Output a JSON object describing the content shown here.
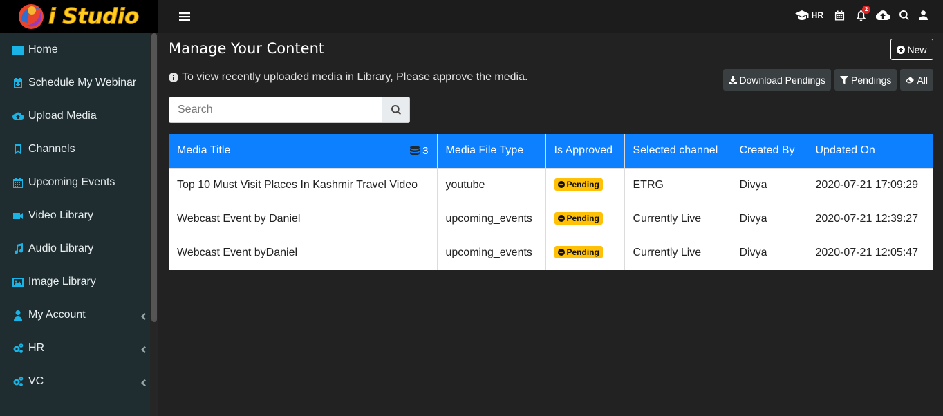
{
  "app": {
    "name": "i Studio"
  },
  "sidebar": {
    "items": [
      {
        "label": "Home",
        "icon": "home-icon",
        "has_chevron": false
      },
      {
        "label": "Schedule My Webinar",
        "icon": "calendar-plus-icon",
        "has_chevron": false
      },
      {
        "label": "Upload Media",
        "icon": "cloud-upload-icon",
        "has_chevron": false
      },
      {
        "label": "Channels",
        "icon": "bookmark-icon",
        "has_chevron": false
      },
      {
        "label": "Upcoming Events",
        "icon": "calendar-icon",
        "has_chevron": false
      },
      {
        "label": "Video Library",
        "icon": "video-icon",
        "has_chevron": false
      },
      {
        "label": "Audio Library",
        "icon": "music-icon",
        "has_chevron": false
      },
      {
        "label": "Image Library",
        "icon": "image-icon",
        "has_chevron": false
      },
      {
        "label": "My Account",
        "icon": "user-icon",
        "has_chevron": true
      },
      {
        "label": "HR",
        "icon": "cogs-icon",
        "has_chevron": true
      },
      {
        "label": "VC",
        "icon": "cogs-icon",
        "has_chevron": true
      }
    ]
  },
  "topbar": {
    "hr_label": "HR",
    "notification_count": "2"
  },
  "main": {
    "title": "Manage Your Content",
    "new_button": "New",
    "info": "To view recently uploaded media in Library, Please approve the media.",
    "buttons": {
      "download_pendings": "Download Pendings",
      "pendings": "Pendings",
      "all": "All"
    },
    "search": {
      "placeholder": "Search",
      "value": ""
    },
    "table": {
      "count": "3",
      "headers": [
        "Media Title",
        "Media File Type",
        "Is Approved",
        "Selected channel",
        "Created By",
        "Updated On"
      ],
      "rows": [
        {
          "title": "Top 10 Must Visit Places In Kashmir Travel Video",
          "type": "youtube",
          "status": "Pending",
          "channel": "ETRG",
          "created_by": "Divya",
          "updated": "2020-07-21 17:09:29"
        },
        {
          "title": "Webcast Event by Daniel",
          "type": "upcoming_events",
          "status": "Pending",
          "channel": "Currently Live",
          "created_by": "Divya",
          "updated": "2020-07-21 12:39:27"
        },
        {
          "title": "Webcast Event byDaniel",
          "type": "upcoming_events",
          "status": "Pending",
          "channel": "Currently Live",
          "created_by": "Divya",
          "updated": "2020-07-21 12:05:47"
        }
      ]
    }
  },
  "colors": {
    "accent": "#0d80ff",
    "sidebar_icon": "#1ab3e6",
    "pending": "#ffc107",
    "logo": "#ffcc1f"
  }
}
